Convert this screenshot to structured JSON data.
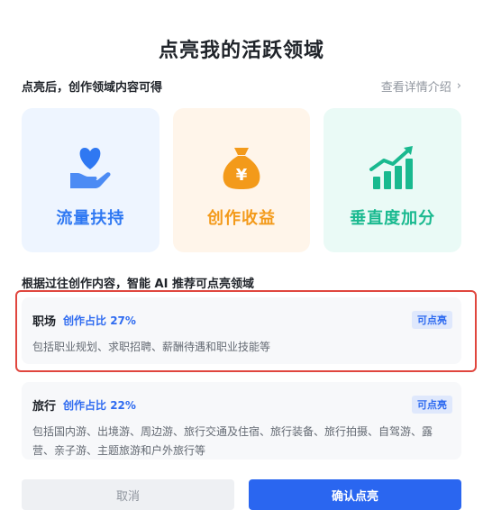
{
  "dialog": {
    "title": "点亮我的活跃领域",
    "subhead": "点亮后，创作领域内容可得",
    "detail_link": "查看详情介绍",
    "detail_chevron": "›"
  },
  "benefits": [
    {
      "label": "流量扶持",
      "icon": "heart-hand-icon",
      "color": "#2f78f2"
    },
    {
      "label": "创作收益",
      "icon": "money-bag-icon",
      "color": "#f39a1a"
    },
    {
      "label": "垂直度加分",
      "icon": "growth-chart-icon",
      "color": "#19b98f"
    }
  ],
  "recommend": {
    "title": "根据过往创作内容，智能 AI 推荐可点亮领域",
    "items": [
      {
        "name": "职场",
        "ratio": "创作占比 27%",
        "badge": "可点亮",
        "desc": "包括职业规划、求职招聘、薪酬待遇和职业技能等"
      },
      {
        "name": "旅行",
        "ratio": "创作占比 22%",
        "badge": "可点亮",
        "desc": "包括国内游、出境游、周边游、旅行交通及住宿、旅行装备、旅行拍摄、自驾游、露营、亲子游、主题旅游和户外旅行等"
      }
    ]
  },
  "buttons": {
    "cancel": "取消",
    "confirm": "确认点亮"
  },
  "colors": {
    "primary": "#2a66f0",
    "highlight_border": "#e0463e"
  }
}
